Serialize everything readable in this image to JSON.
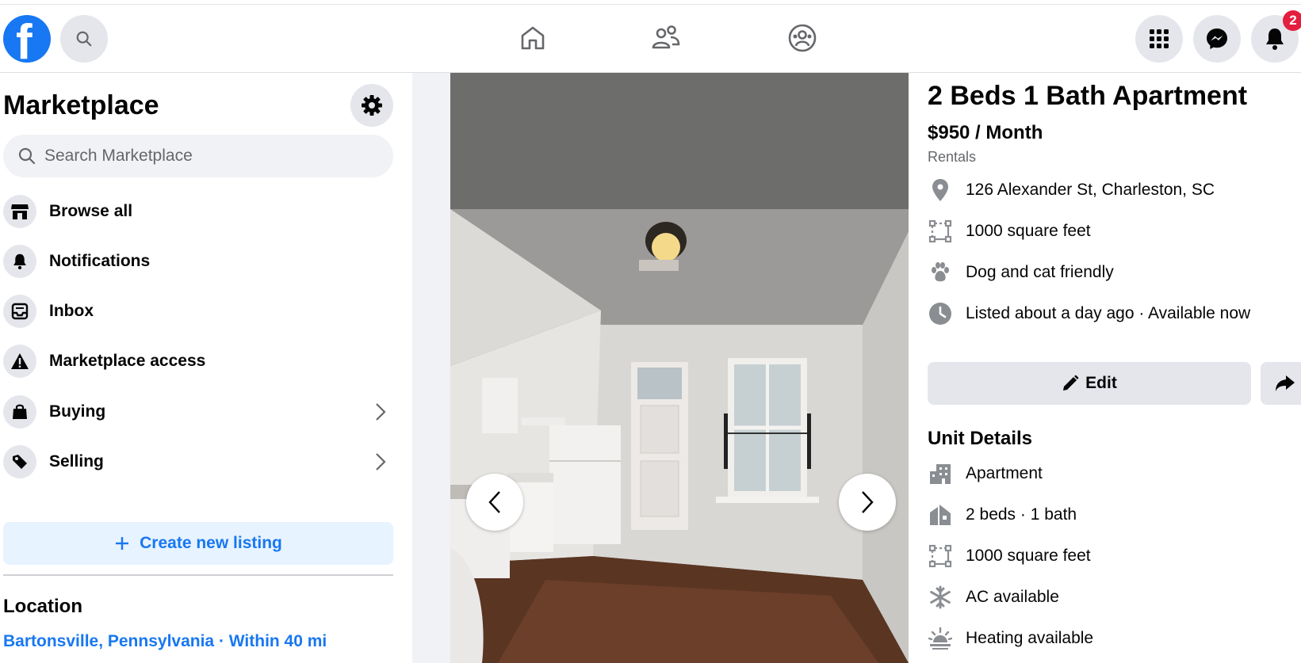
{
  "header": {
    "logo_letter": "f",
    "notifications_badge": "2"
  },
  "sidebar": {
    "title": "Marketplace",
    "search_placeholder": "Search Marketplace",
    "items": [
      {
        "label": "Browse all"
      },
      {
        "label": "Notifications"
      },
      {
        "label": "Inbox"
      },
      {
        "label": "Marketplace access"
      },
      {
        "label": "Buying"
      },
      {
        "label": "Selling"
      }
    ],
    "create_label": "Create new listing",
    "location_title": "Location",
    "location_value": "Bartonsville, Pennsylvania · Within 40 mi"
  },
  "listing": {
    "title": "2 Beds 1 Bath Apartment",
    "price": "$950 / Month",
    "category": "Rentals",
    "facts": [
      {
        "icon": "location-pin-icon",
        "text": "126 Alexander St, Charleston, SC"
      },
      {
        "icon": "area-icon",
        "text": "1000 square feet"
      },
      {
        "icon": "paw-icon",
        "text": "Dog and cat friendly"
      },
      {
        "icon": "clock-icon",
        "text": "Listed about a day ago · Available now"
      }
    ],
    "edit_label": "Edit",
    "unit_details_title": "Unit Details",
    "unit_details": [
      {
        "icon": "building-icon",
        "text": "Apartment"
      },
      {
        "icon": "house-icon",
        "text": "2 beds · 1 bath"
      },
      {
        "icon": "area-icon",
        "text": "1000 square feet"
      },
      {
        "icon": "snowflake-icon",
        "text": "AC available"
      },
      {
        "icon": "heating-icon",
        "text": "Heating available"
      }
    ]
  },
  "colors": {
    "brand": "#1877f2",
    "badge": "#e41e3f",
    "secondary_text": "#65676b",
    "button_bg": "#e4e6eb"
  }
}
